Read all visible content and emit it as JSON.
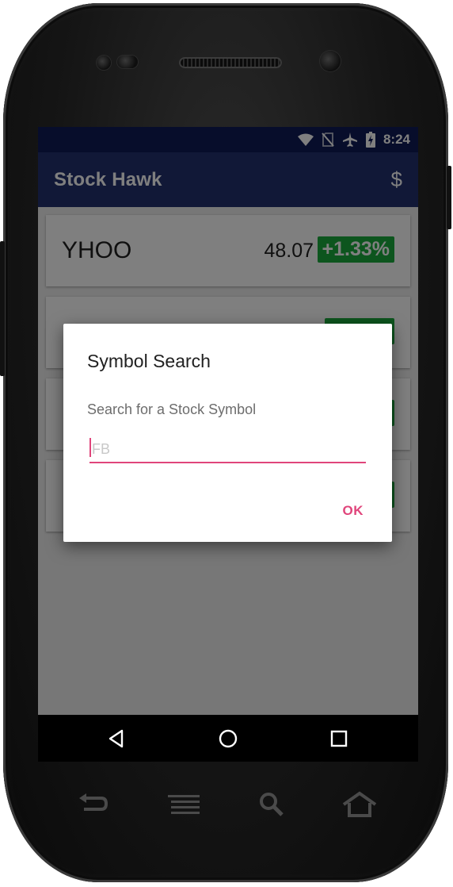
{
  "status_bar": {
    "time": "8:24",
    "icons": [
      "wifi-icon",
      "no-sim-icon",
      "airplane-icon",
      "battery-charging-icon"
    ]
  },
  "toolbar": {
    "title": "Stock Hawk",
    "action_label": "$"
  },
  "stocks": [
    {
      "symbol": "YHOO",
      "price": "48.07",
      "change": "+1.33%"
    }
  ],
  "dialog": {
    "title": "Symbol Search",
    "message": "Search for a Stock Symbol",
    "input_value": "",
    "input_placeholder": "FB",
    "ok_label": "OK"
  },
  "fab": {
    "icon": "plus-icon",
    "label": "+"
  },
  "nav_bar": {
    "icons": [
      "back-icon",
      "home-icon",
      "recents-icon"
    ]
  },
  "hardware_keys": {
    "icons": [
      "back-key-icon",
      "menu-key-icon",
      "search-key-icon",
      "home-key-icon"
    ]
  },
  "colors": {
    "primary": "#23306e",
    "primary_dark": "#0f1a56",
    "accent": "#e0457b",
    "positive": "#1bab3c",
    "fab": "#2e7fd8"
  }
}
